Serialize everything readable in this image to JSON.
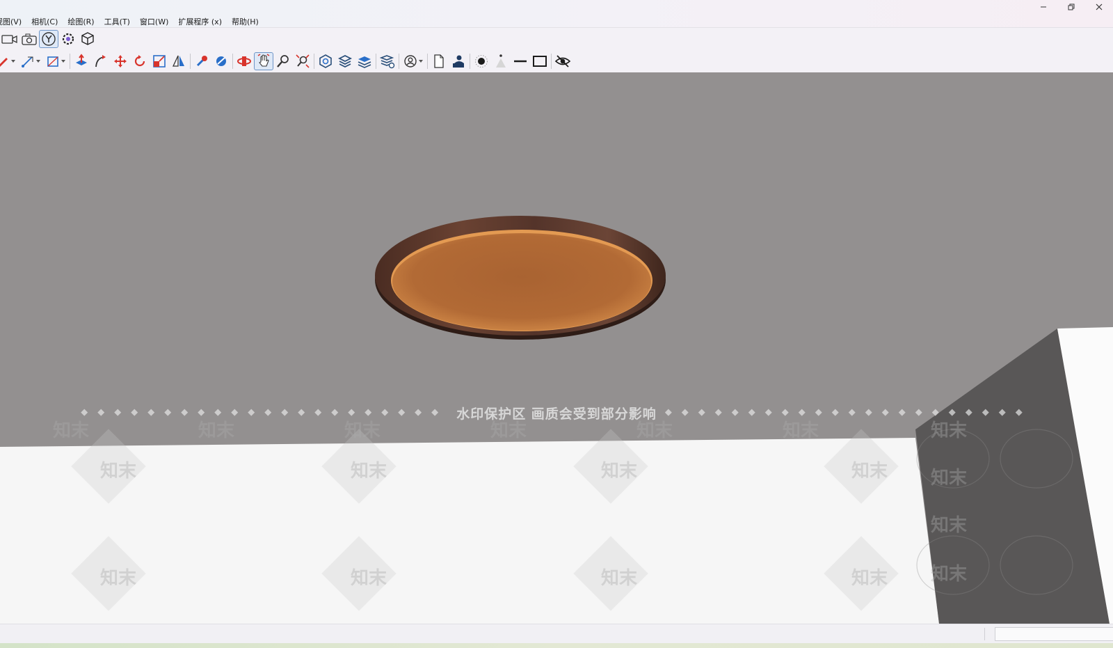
{
  "menu": {
    "items": [
      "视图(V)",
      "相机(C)",
      "绘图(R)",
      "工具(T)",
      "窗口(W)",
      "扩展程序 (x)",
      "帮助(H)"
    ]
  },
  "window_controls": [
    "minimize-icon",
    "restore-icon",
    "close-icon"
  ],
  "toolbar_top": [
    "video-camera-icon",
    "camera-icon",
    "y-axis-view-icon",
    "component-gear-icon",
    "box-export-icon"
  ],
  "toolbar_main": [
    "pencil-icon",
    "line-tool-icon",
    "rectangle-tool-icon",
    "push-pull-icon",
    "follow-me-icon",
    "move-icon",
    "rotate-icon",
    "scale-icon",
    "mirror-icon",
    "paint-icon",
    "material-icon",
    "orbit-icon",
    "pan-icon",
    "zoom-icon",
    "zoom-extents-icon",
    "component-icon",
    "layers-icon",
    "layers-stack-icon",
    "layers-settings-icon",
    "user-circle-icon",
    "document-icon",
    "person-icon",
    "sun-icon",
    "shadow-icon",
    "line-icon",
    "square-icon",
    "hidden-eye-icon"
  ],
  "watermark": {
    "banner": "水印保护区   画质会受到部分影响",
    "mark": "知末"
  },
  "colors": {
    "ceiling": "#939090",
    "wood_rim": "#5b3a2c",
    "lamp_glow": "#b87137",
    "floor": "#f6f6f6",
    "wall": "#5a5858",
    "active_tool": "#6e95c8"
  }
}
